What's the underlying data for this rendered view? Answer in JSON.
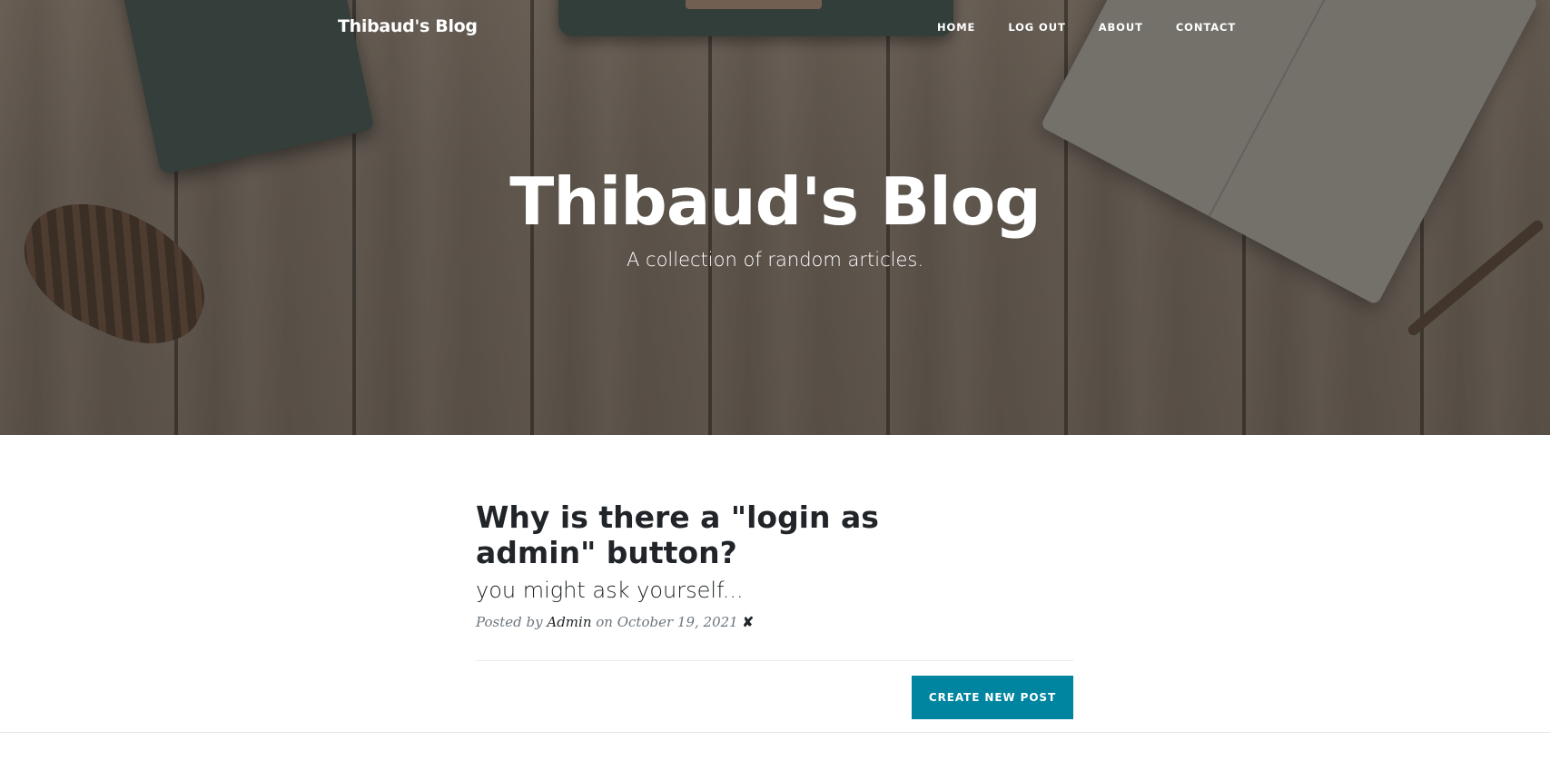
{
  "nav": {
    "brand": "Thibaud's Blog",
    "links": [
      {
        "label": "HOME"
      },
      {
        "label": "LOG OUT"
      },
      {
        "label": "ABOUT"
      },
      {
        "label": "CONTACT"
      }
    ]
  },
  "hero": {
    "title": "Thibaud's Blog",
    "subtitle": "A collection of random articles."
  },
  "posts": [
    {
      "title": "Why is there a \"login as admin\" button?",
      "subtitle": "you might ask yourself...",
      "meta_prefix": "Posted by",
      "author": "Admin",
      "meta_on": "on October 19, 2021",
      "delete_symbol": "✘"
    }
  ],
  "actions": {
    "create_label": "CREATE NEW POST"
  },
  "colors": {
    "accent": "#0085a1",
    "text": "#212529",
    "muted": "#6c757d"
  }
}
